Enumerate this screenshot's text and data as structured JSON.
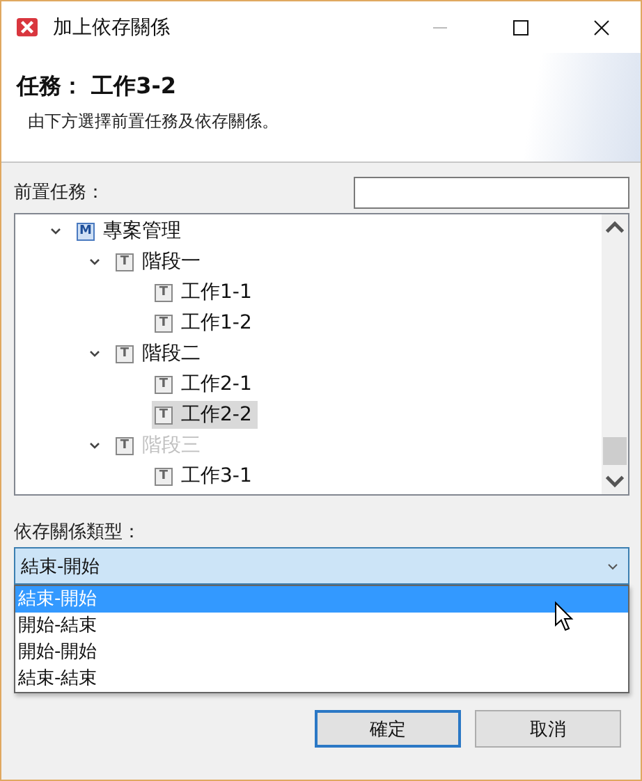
{
  "window": {
    "title": "加上依存關係"
  },
  "header": {
    "title": "任務： 工作3-2",
    "subtitle": "由下方選擇前置任務及依存關係。"
  },
  "predecessor": {
    "label": "前置任務：",
    "tree": [
      {
        "label": "專案管理",
        "badge": "M",
        "expanded": true,
        "selected": false,
        "disabled": false,
        "children": [
          {
            "label": "階段一",
            "badge": "T",
            "expanded": true,
            "selected": false,
            "disabled": false,
            "children": [
              {
                "label": "工作1-1",
                "badge": "T",
                "selected": false,
                "disabled": false
              },
              {
                "label": "工作1-2",
                "badge": "T",
                "selected": false,
                "disabled": false
              }
            ]
          },
          {
            "label": "階段二",
            "badge": "T",
            "expanded": true,
            "selected": false,
            "disabled": false,
            "children": [
              {
                "label": "工作2-1",
                "badge": "T",
                "selected": false,
                "disabled": false
              },
              {
                "label": "工作2-2",
                "badge": "T",
                "selected": true,
                "disabled": false
              }
            ]
          },
          {
            "label": "階段三",
            "badge": "T",
            "expanded": true,
            "selected": false,
            "disabled": true,
            "children": [
              {
                "label": "工作3-1",
                "badge": "T",
                "selected": false,
                "disabled": false
              }
            ]
          }
        ]
      }
    ]
  },
  "dependency": {
    "label": "依存關係類型：",
    "value": "結束-開始",
    "options": [
      {
        "label": "結束-開始",
        "selected": true
      },
      {
        "label": "開始-結束",
        "selected": false
      },
      {
        "label": "開始-開始",
        "selected": false
      },
      {
        "label": "結束-結束",
        "selected": false
      }
    ]
  },
  "buttons": [
    {
      "label": "確定",
      "kind": "default"
    },
    {
      "label": "取消",
      "kind": "normal"
    }
  ]
}
